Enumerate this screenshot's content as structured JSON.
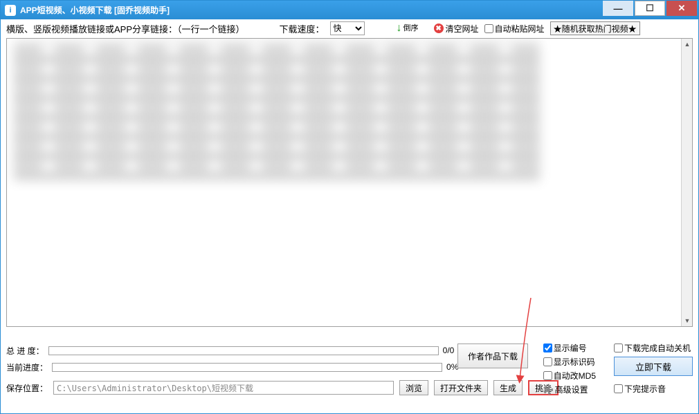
{
  "window": {
    "title": "APP短视频、小视频下载 [固乔视频助手]"
  },
  "toolbar": {
    "link_label": "横版、竖版视频播放链接或APP分享链接：（一行一个链接）",
    "speed_label": "下载速度：",
    "speed_value": "快",
    "sort_label": "倒序",
    "clear_label": "清空网址",
    "auto_paste_label": "自动粘贴网址",
    "random_hot_label": "★随机获取热门视频★"
  },
  "progress": {
    "total_label": "总 进 度：",
    "current_label": "当前进度：",
    "total_text": "0/0",
    "current_text": "0%"
  },
  "path": {
    "label": "保存位置：",
    "value": "C:\\Users\\Administrator\\Desktop\\短视频下载",
    "browse": "浏览",
    "open_folder": "打开文件夹",
    "generate": "生成",
    "pick": "挑选"
  },
  "buttons": {
    "author_download": "作者作品下载",
    "download_now": "立即下载"
  },
  "options": {
    "show_number": "显示编号",
    "show_idcode": "显示标识码",
    "auto_md5": "自动改MD5",
    "advanced": "高级设置",
    "auto_shutdown": "下载完成自动关机",
    "finish_sound": "下完提示音"
  }
}
